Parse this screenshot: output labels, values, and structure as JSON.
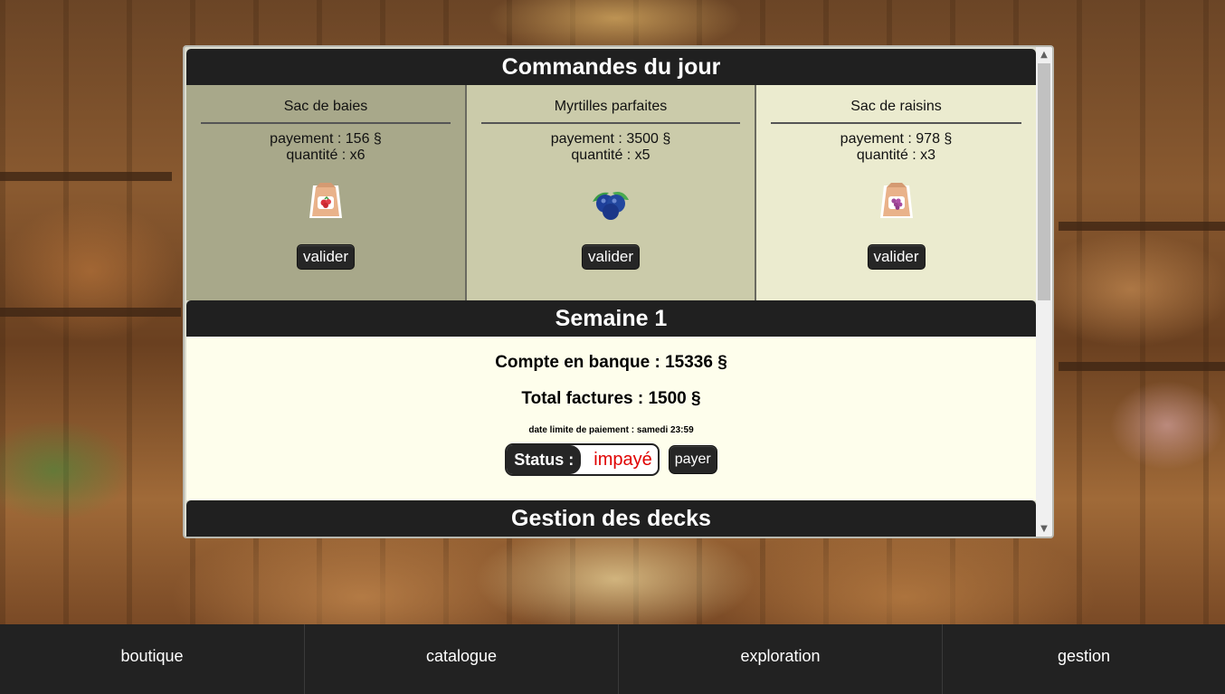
{
  "orders_section": {
    "title": "Commandes du jour",
    "orders": [
      {
        "name": "Sac de baies",
        "payment": "payement : 156 §",
        "quantity": "quantité : x6",
        "icon": "berry-bag-icon",
        "button": "valider",
        "bg": "#a8a88a"
      },
      {
        "name": "Myrtilles parfaites",
        "payment": "payement : 3500 §",
        "quantity": "quantité : x5",
        "icon": "blueberry-icon",
        "button": "valider",
        "bg": "#cbcbaa"
      },
      {
        "name": "Sac de raisins",
        "payment": "payement : 978 §",
        "quantity": "quantité : x3",
        "icon": "grape-bag-icon",
        "button": "valider",
        "bg": "#ebebcf"
      }
    ]
  },
  "week_section": {
    "title": "Semaine 1",
    "bank": "Compte en banque : 15336 §",
    "bills": "Total factures : 1500 §",
    "deadline": "date limite de paiement : samedi 23:59",
    "status_label": "Status :",
    "status_value": "impayé",
    "pay_button": "payer"
  },
  "decks_section": {
    "title": "Gestion des decks"
  },
  "nav": {
    "items": [
      "boutique",
      "catalogue",
      "exploration",
      "gestion"
    ]
  },
  "colors": {
    "header_bg": "#202020",
    "status_unpaid": "#e00000",
    "nav_bg": "#222222"
  }
}
